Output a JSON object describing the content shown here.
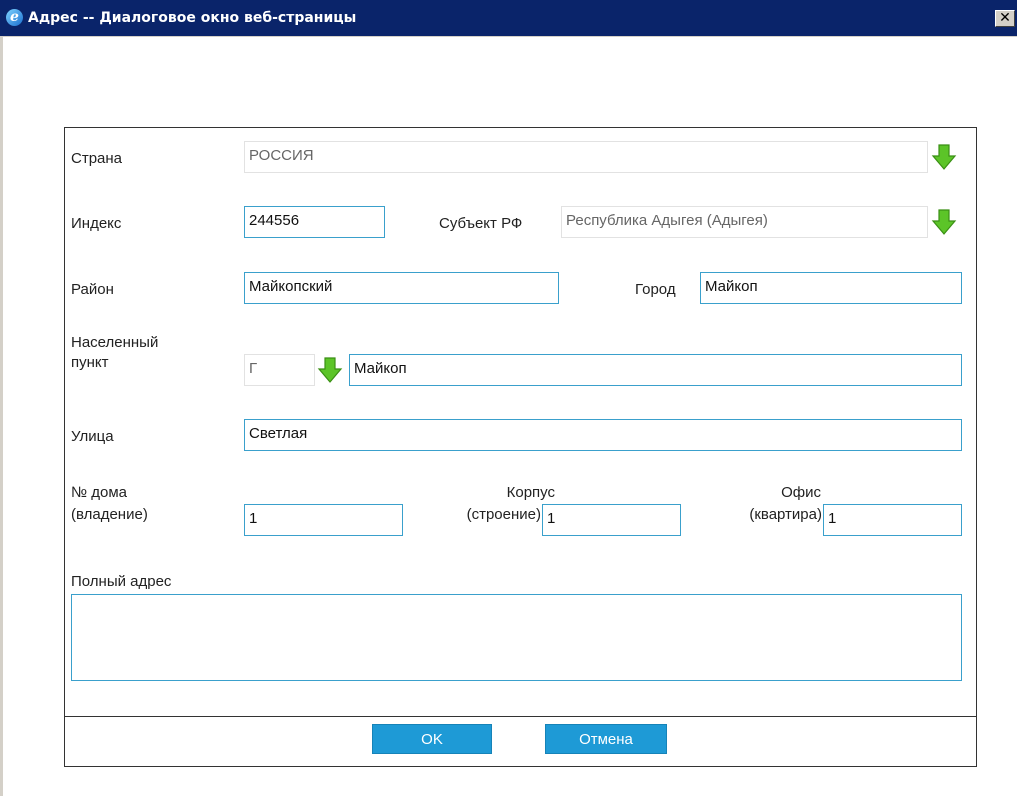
{
  "window": {
    "title": "Адрес -- Диалоговое окно веб-страницы",
    "close_glyph": "✕",
    "icon": "ie-icon"
  },
  "form": {
    "country": {
      "label": "Страна",
      "value": "РОССИЯ"
    },
    "index": {
      "label": "Индекс",
      "value": "244556"
    },
    "subject": {
      "label": "Субъект РФ",
      "value": "Республика Адыгея (Адыгея)"
    },
    "district": {
      "label": "Район",
      "value": "Майкопский"
    },
    "city": {
      "label": "Город",
      "value": "Майкоп"
    },
    "locality": {
      "label_line1": "Населенный",
      "label_line2": "пункт",
      "type_value": "Г",
      "value": "Майкоп"
    },
    "street": {
      "label": "Улица",
      "value": "Светлая"
    },
    "house": {
      "label_line1": "№ дома",
      "label_line2": "(владение)",
      "value": "1"
    },
    "building": {
      "label_line1": "Корпус",
      "label_line2": "(строение)",
      "value": "1"
    },
    "office": {
      "label_line1": "Офис",
      "label_line2": "(квартира)",
      "value": "1"
    },
    "full_address": {
      "label": "Полный адрес",
      "value": ""
    }
  },
  "buttons": {
    "ok": "OK",
    "cancel": "Отмена"
  },
  "colors": {
    "accent": "#1e9ad6",
    "field_border": "#3aa0cc",
    "arrow_green": "#5cc428"
  }
}
